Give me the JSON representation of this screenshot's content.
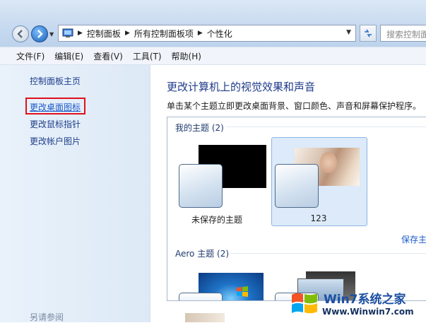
{
  "address_bar": {
    "breadcrumb": [
      "控制面板",
      "所有控制面板项",
      "个性化"
    ],
    "search_placeholder": "搜索控制面板"
  },
  "menu": {
    "items": [
      "文件(F)",
      "编辑(E)",
      "查看(V)",
      "工具(T)",
      "帮助(H)"
    ]
  },
  "sidebar": {
    "home": "控制面板主页",
    "links": [
      "更改桌面图标",
      "更改鼠标指针",
      "更改帐户图片"
    ],
    "see_also": "另请参阅"
  },
  "main": {
    "title": "更改计算机上的视觉效果和声音",
    "subtitle": "单击某个主题立即更改桌面背景、窗口颜色、声音和屏幕保护程序。",
    "my_themes_header": "我的主题 (2)",
    "themes": [
      {
        "label": "未保存的主题",
        "selected": false
      },
      {
        "label": "123",
        "selected": true
      }
    ],
    "save_link": "保存主",
    "aero_header": "Aero 主题 (2)"
  },
  "colors": {
    "highlight_box": "#e0101c",
    "link": "#1d5ac9",
    "title": "#1e3a8a"
  },
  "watermark": {
    "title": "Win7系统之家",
    "url": "Www.Winwin7.com"
  }
}
